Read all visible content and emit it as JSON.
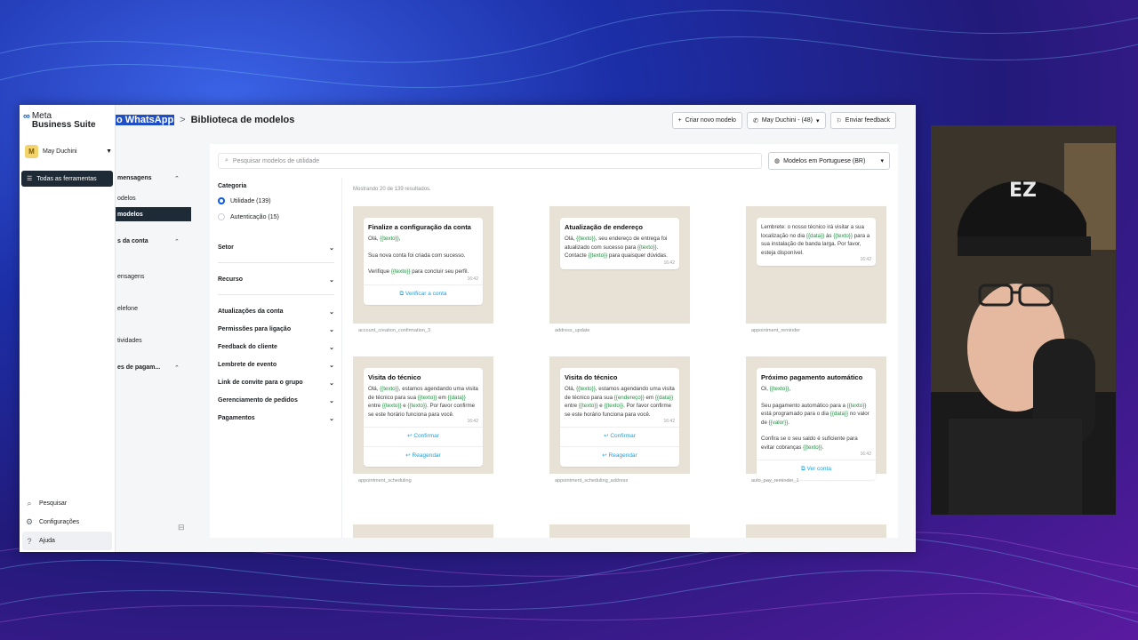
{
  "sidebar": {
    "logo_line1": "Meta",
    "logo_line2": "Business Suite",
    "account_name": "May Duchini",
    "account_initial": "M",
    "all_tools": "Todas as ferramentas",
    "bottom": [
      {
        "label": "Pesquisar",
        "icon": "search-icon"
      },
      {
        "label": "Configurações",
        "icon": "gear-icon"
      },
      {
        "label": "Ajuda",
        "icon": "help-icon"
      }
    ]
  },
  "subnav": {
    "section1": "mensagens",
    "item1": "odelos",
    "item1_selected": "modelos",
    "section2": "s da conta",
    "item2": "ensagens",
    "item3": "elefone",
    "item4": "tividades",
    "section3": "es de pagam..."
  },
  "header": {
    "breadcrumb_parent": "o WhatsApp",
    "breadcrumb_sep": ">",
    "breadcrumb_current": "Biblioteca de modelos",
    "create_button": "Criar novo modelo",
    "account_button": "May Duchini - (48)",
    "feedback_button": "Enviar feedback"
  },
  "search": {
    "placeholder": "Pesquisar modelos de utilidade"
  },
  "language_select": "Modelos em Portuguese (BR)",
  "filters": {
    "category_label": "Categoria",
    "options": [
      "Utilidade (139)",
      "Autenticação (15)"
    ],
    "sections": [
      "Setor",
      "Recurso",
      "Atualizações da conta",
      "Permissões para ligação",
      "Feedback do cliente",
      "Lembrete de evento",
      "Link de convite para o grupo",
      "Gerenciamento de pedidos",
      "Pagamentos"
    ]
  },
  "results_text": "Mostrando 20 de 139 resultados.",
  "cards": [
    {
      "title": "Finalize a configuração da conta",
      "lines": [
        "Olá, {{texto}},",
        "",
        "Sua nova conta foi criada com sucesso.",
        "",
        "Verifique {{texto}} para concluir seu perfil."
      ],
      "time": "16:42",
      "actions": [
        "Verificar a conta"
      ],
      "name": "account_creation_confirmation_3"
    },
    {
      "title": "Atualização de endereço",
      "lines": [
        "Olá, {{texto}}, seu endereço de entrega foi atualizado com sucesso para {{texto}}. Contacte {{texto}} para quaisquer dúvidas."
      ],
      "time": "16:42",
      "actions": [],
      "name": "address_update"
    },
    {
      "title": "",
      "lines": [
        "Lembrete: o nosso técnico irá visitar a sua localização no dia {{data}} às {{texto}} para a sua instalação de banda larga. Por favor, esteja disponível."
      ],
      "time": "16:42",
      "actions": [],
      "name": "appointment_reminder"
    },
    {
      "title": "Visita do técnico",
      "lines": [
        "Olá, {{texto}}, estamos agendando uma visita de técnico para sua {{texto}} em {{data}} entre {{texto}} e {{texto}}. Por favor confirme se este horário funciona para você."
      ],
      "time": "16:42",
      "actions": [
        "Confirmar",
        "Reagendar"
      ],
      "name": "appointment_scheduling"
    },
    {
      "title": "Visita do técnico",
      "lines": [
        "Olá, {{texto}}, estamos agendando uma visita de técnico para sua {{endereço}} em {{data}} entre {{texto}} e {{texto}}. Por favor confirme se este horário funciona para você."
      ],
      "time": "16:42",
      "actions": [
        "Confirmar",
        "Reagendar"
      ],
      "name": "appointment_scheduling_address"
    },
    {
      "title": "Próximo pagamento automático",
      "lines": [
        "Oi, {{texto}},",
        "",
        "Seu pagamento automático para a {{texto}} está programado para o dia {{data}} no valor de {{valor}}.",
        "",
        "Confira se o seu saldo é suficiente para evitar cobranças {{texto}}."
      ],
      "time": "16:42",
      "actions": [
        "Ver conta"
      ],
      "name": "auto_pay_reminder_1"
    }
  ],
  "colors": {
    "accent": "#0a59e4",
    "dark_nav": "#1e2a36",
    "link": "#1f9fd8",
    "variable": "#1e8e3e",
    "chat_bg": "#e8e1d6"
  }
}
